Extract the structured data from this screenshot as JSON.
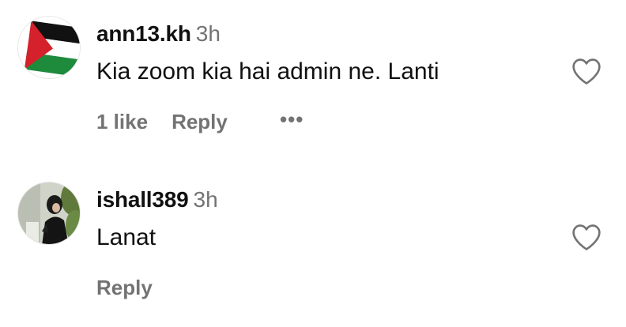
{
  "comments": [
    {
      "username": "ann13.kh",
      "time": "3h",
      "text": "Kia zoom kia hai admin ne. Lanti",
      "likes": "1 like",
      "reply": "Reply",
      "more": "•••",
      "avatar_icon": "palestine-flag",
      "liked": false
    },
    {
      "username": "ishall389",
      "time": "3h",
      "text": "Lanat",
      "reply": "Reply",
      "avatar_icon": "profile-photo",
      "liked": false
    }
  ],
  "colors": {
    "text": "#111111",
    "secondary": "#737373",
    "heart_stroke": "#737373",
    "flag_red": "#d4212b",
    "flag_green": "#1e8a3c",
    "flag_black": "#111111"
  }
}
